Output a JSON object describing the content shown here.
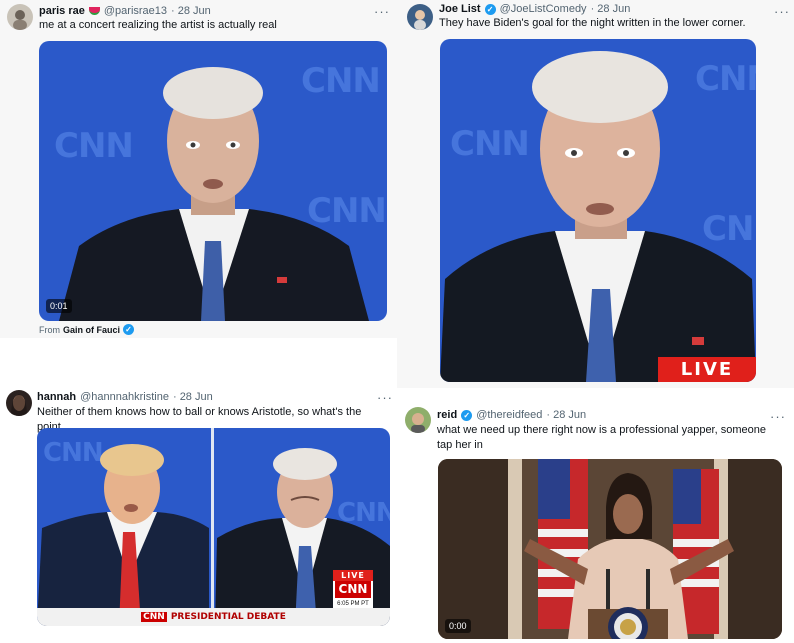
{
  "tweets": [
    {
      "name": "paris rae",
      "handle": "@parisrae13",
      "date": "· 28 Jun",
      "text": "me at a concert realizing the artist is actually real",
      "media": {
        "timecode": "0:01"
      },
      "source": {
        "prefix": "From",
        "name": "Gain of Fauci"
      }
    },
    {
      "name": "Joe List",
      "handle": "@JoeListComedy",
      "date": "· 28 Jun",
      "text": "They have Biden's goal for the night written in the lower corner.",
      "media": {
        "live": "LIVE"
      }
    },
    {
      "name": "hannah",
      "handle": "@hannnahkristine",
      "date": "· 28 Jun",
      "text": "Neither of them knows how to ball or knows Aristotle, so what's the point",
      "media": {
        "live": "LIVE",
        "clock": "6:05 PM PT",
        "banner_logo": "CNN",
        "banner_text": "PRESIDENTIAL DEBATE",
        "live_logo": "CNN"
      }
    },
    {
      "name": "reid",
      "handle": "@thereidfeed",
      "date": "· 28 Jun",
      "text": "what we need up there right now is a professional yapper, someone tap her in",
      "media": {
        "timecode": "0:00"
      }
    }
  ],
  "more_label": "···",
  "verified_glyph": "✓",
  "watermark": "CNN",
  "colors": {
    "cnn_blue": "#2b59c9",
    "live_red": "#e0201b",
    "verified": "#1d9bf0",
    "secondary_text": "#536471"
  }
}
